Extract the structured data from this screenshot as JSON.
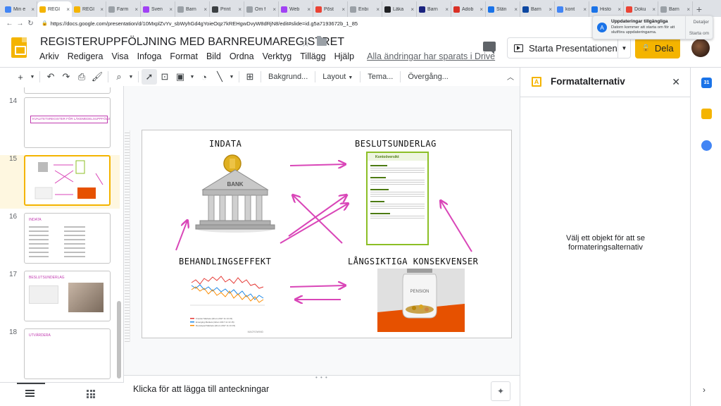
{
  "browser": {
    "tabs": [
      {
        "title": "Min e",
        "color": "#4285f4",
        "active": false
      },
      {
        "title": "REGI",
        "color": "#f4b400",
        "active": true
      },
      {
        "title": "REGI",
        "color": "#f4b400",
        "active": false
      },
      {
        "title": "Farm",
        "color": "#9aa0a6",
        "active": false
      },
      {
        "title": "Sven",
        "color": "#a142f4",
        "active": false
      },
      {
        "title": "Barn",
        "color": "#9aa0a6",
        "active": false
      },
      {
        "title": "Print",
        "color": "#3c4043",
        "active": false
      },
      {
        "title": "Om f",
        "color": "#9aa0a6",
        "active": false
      },
      {
        "title": "Web",
        "color": "#a142f4",
        "active": false
      },
      {
        "title": "Pōst",
        "color": "#ea4335",
        "active": false
      },
      {
        "title": "Enbi",
        "color": "#9aa0a6",
        "active": false
      },
      {
        "title": "Läka",
        "color": "#202124",
        "active": false
      },
      {
        "title": "Barn",
        "color": "#1a237e",
        "active": false
      },
      {
        "title": "Adob",
        "color": "#d93025",
        "active": false
      },
      {
        "title": "Stän",
        "color": "#1a73e8",
        "active": false
      },
      {
        "title": "Barn",
        "color": "#0d47a1",
        "active": false
      },
      {
        "title": "kont",
        "color": "#4285f4",
        "active": false
      },
      {
        "title": "Histo",
        "color": "#1a73e8",
        "active": false
      },
      {
        "title": "Doku",
        "color": "#ea4335",
        "active": false
      },
      {
        "title": "Barn",
        "color": "#9aa0a6",
        "active": false
      }
    ],
    "new_tab": "+",
    "url": "https://docs.google.com/presentation/d/10MxplZvYv_sbWyhGd4gYoieOqz7kREHgwDvyW8dRjN8/edit#slide=id.g5a7193672b_1_85"
  },
  "notification": {
    "title": "Uppdateringar tillgängliga",
    "body": "Datorn kommer att starta om för att slutföra uppdateringarna.",
    "details": "Detaljer",
    "restart": "Starta om"
  },
  "doc": {
    "title": "REGISTERUPPFÖLJNING MED BARNREUMAREGISTRET",
    "menu": [
      "Arkiv",
      "Redigera",
      "Visa",
      "Infoga",
      "Format",
      "Bild",
      "Ordna",
      "Verktyg",
      "Tillägg",
      "Hjälp"
    ],
    "saved": "Alla ändringar har sparats i Drive",
    "present": "Starta Presentationen",
    "share": "Dela"
  },
  "toolbar": {
    "background": "Bakgrund...",
    "layout": "Layout",
    "theme": "Tema...",
    "transition": "Övergång..."
  },
  "filmstrip": {
    "slides": [
      {
        "num": "14",
        "active": false,
        "text": "KVALITETSREGISTER FÖR LÄKEMEDELSUPPFÖLJNING"
      },
      {
        "num": "15",
        "active": true,
        "text": ""
      },
      {
        "num": "16",
        "active": false,
        "text": "INDATA"
      },
      {
        "num": "17",
        "active": false,
        "text": "BESLUTSUNDERLAG"
      },
      {
        "num": "18",
        "active": false,
        "text": "UTVÄRDERA"
      }
    ]
  },
  "slide": {
    "labels": {
      "indata": "INDATA",
      "beslut": "BESLUTSUNDERLAG",
      "behandling": "BEHANDLINGSEFFEKT",
      "langsiktiga": "LÅNGSIKTIGA KONSEKVENSER"
    },
    "bank_text": "BANK",
    "account_title": "Kontoöversikt",
    "jar_text": "PENSION",
    "chart_brand": "MACROWIND",
    "chart_legend": [
      "Frontier Markets (Idrum 2017 11 13 15)",
      "Emerging Markets (Idrum 2017 11 13 15)",
      "Developed Markets (Idrum 2017 11 13 15)"
    ],
    "accent": "#d946b8"
  },
  "notes": {
    "placeholder": "Klicka för att lägga till anteckningar"
  },
  "format_panel": {
    "title": "Formatalternativ",
    "message": "Välj ett objekt för att se formateringsalternativ"
  }
}
